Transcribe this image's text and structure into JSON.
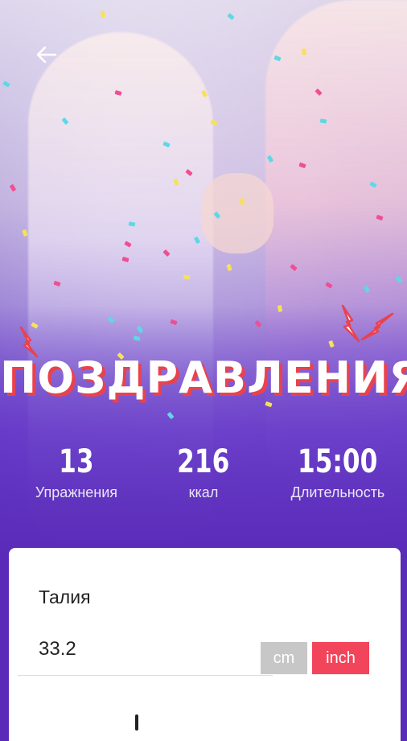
{
  "header": {
    "back_icon": "arrow-left-icon"
  },
  "banner": {
    "title": "ПОЗДРАВЛЕНИЯ",
    "title_shadow_color": "#e9424f"
  },
  "stats": [
    {
      "value": "13",
      "label": "Упражнения"
    },
    {
      "value": "216",
      "label": "ккал"
    },
    {
      "value": "15:00",
      "label": "Длительность"
    }
  ],
  "measurement": {
    "title": "Талия",
    "value": "33.2",
    "units": {
      "cm": "cm",
      "inch": "inch"
    },
    "selected_unit": "inch",
    "active_color": "#f2455b",
    "inactive_color": "#c7c7c7"
  },
  "colors": {
    "background": "#5a2bb8",
    "card": "#ffffff"
  }
}
